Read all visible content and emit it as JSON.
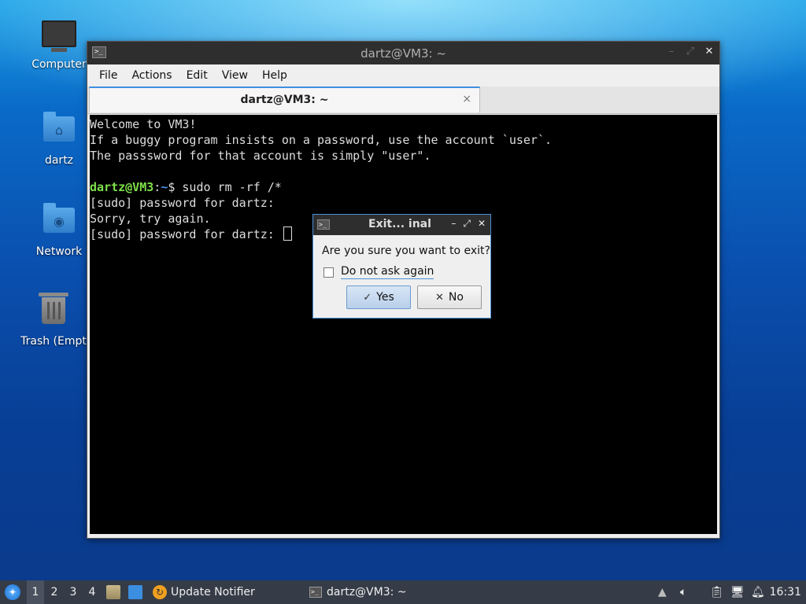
{
  "desktop": {
    "icons": [
      {
        "label": "Computer"
      },
      {
        "label": "dartz"
      },
      {
        "label": "Network"
      },
      {
        "label": "Trash (Empt"
      }
    ]
  },
  "window": {
    "title": "dartz@VM3: ~",
    "menu": [
      "File",
      "Actions",
      "Edit",
      "View",
      "Help"
    ],
    "tab_title": "dartz@VM3: ~",
    "tab_close": "×",
    "terminal": {
      "lines": [
        "Welcome to VM3!",
        "If a buggy program insists on a password, use the account `user`.",
        "The passsword for that account is simply \"user\"."
      ],
      "prompt_user": "dartz@VM3",
      "prompt_colon": ":",
      "prompt_path": "~",
      "prompt_command": "$ sudo rm -rf /*",
      "after": [
        "[sudo] password for dartz:",
        "Sorry, try again.",
        "[sudo] password for dartz: "
      ]
    }
  },
  "dialog": {
    "title": "Exit... inal",
    "message": "Are you sure you want to exit?",
    "checkbox_label": "Do not ask again",
    "checkbox_checked": false,
    "yes_label": "Yes",
    "no_label": "No"
  },
  "taskbar": {
    "workspaces": [
      "1",
      "2",
      "3",
      "4"
    ],
    "active_workspace": "1",
    "update_notifier": "Update Notifier",
    "task_label": "dartz@VM3: ~",
    "clock": "16:31"
  },
  "colors": {
    "prompt_user": "#7ee04a",
    "prompt_path": "#4a90e8",
    "accent": "#3d8fe0",
    "taskbar": "#353c47"
  }
}
